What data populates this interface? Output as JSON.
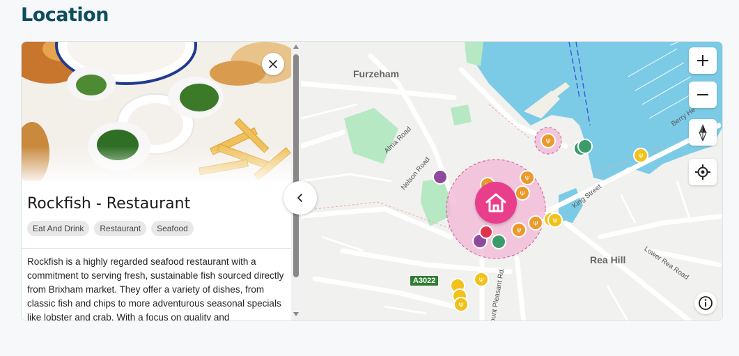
{
  "section": {
    "title": "Location"
  },
  "place": {
    "name": "Rockfish - Restaurant",
    "tags": [
      "Eat And Drink",
      "Restaurant",
      "Seafood"
    ],
    "description": "Rockfish is a highly regarded seafood restaurant with a commitment to serving fresh, sustainable fish sourced directly from Brixham market. They offer a variety of dishes, from classic fish and chips to more adventurous seasonal specials like lobster and crab. With a focus on quality and"
  },
  "map": {
    "labels": {
      "furzeham": "Furzeham",
      "rea_hill": "Rea Hill",
      "alma_road": "Alma Road",
      "nelson_road": "Nelson Road",
      "king_street": "King Street",
      "lower_rea_road": "Lower Rea Road",
      "berry_head": "Berry He",
      "mount_pleasant": "ount Pleasant Rd.",
      "road_badge": "A3022"
    },
    "colors": {
      "water": "#7ccbe6",
      "park": "#b6e8c3",
      "home_marker": "#e83e8c",
      "radius_fill": "#f3b6d5",
      "food_marker": "#e99a2a",
      "yellow_marker": "#f2c21a",
      "purple_marker": "#8e4b9e",
      "green_marker": "#3a9c6b"
    },
    "icons": {
      "zoom_in": "plus-icon",
      "zoom_out": "minus-icon",
      "compass": "compass-icon",
      "locate": "crosshair-icon",
      "info": "info-icon",
      "home": "home-icon",
      "close": "close-icon",
      "collapse": "chevron-left-icon"
    }
  }
}
